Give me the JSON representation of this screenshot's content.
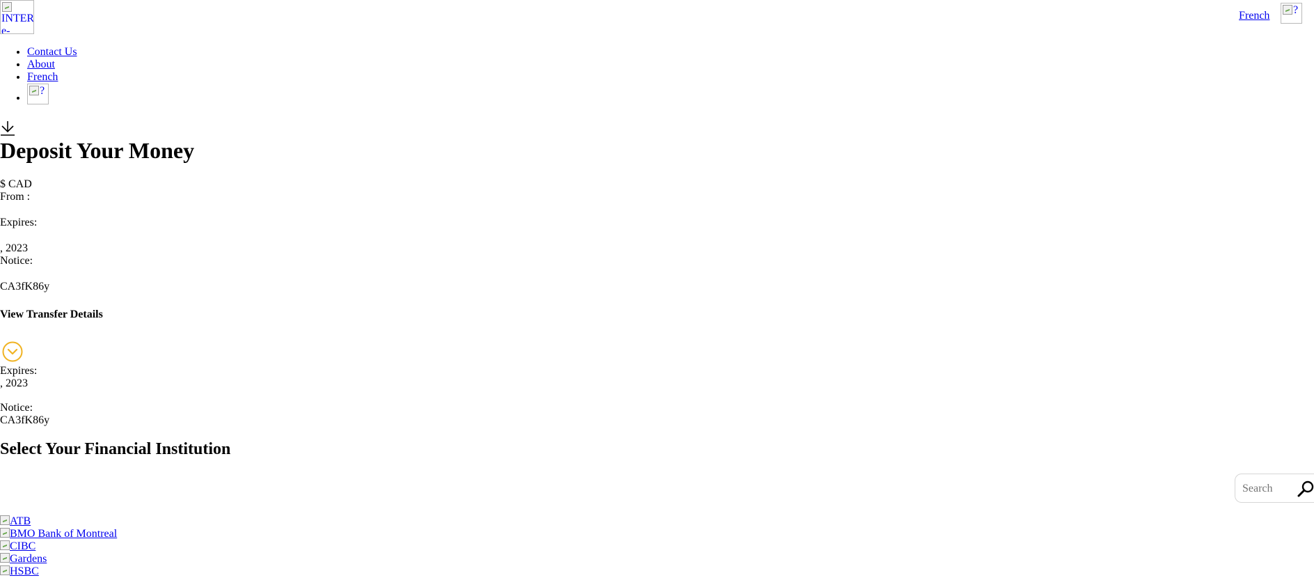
{
  "header": {
    "logo_alt": "INTER e-",
    "language_link": "French",
    "flag_alt": "?"
  },
  "nav": {
    "items": [
      {
        "label": "Contact Us"
      },
      {
        "label": "About"
      },
      {
        "label": "French"
      }
    ],
    "flag_alt": "?"
  },
  "deposit": {
    "title": "Deposit Your Money",
    "amount_text": "$ CAD",
    "from_label": "From :",
    "expires_label": "Expires:",
    "expires_value": ", 2023",
    "notice_label": "Notice:",
    "notice_value": "CA3fK86y",
    "view_details_label": "View Transfer Details"
  },
  "details": {
    "expires_label": "Expires:",
    "expires_value": ", 2023",
    "notice_label": "Notice:",
    "notice_value": "CA3fK86y"
  },
  "institutions": {
    "heading": "Select Your Financial Institution",
    "search_placeholder": "Search",
    "banks": [
      {
        "name": "ATB"
      },
      {
        "name": "BMO Bank of Montreal"
      },
      {
        "name": "CIBC"
      },
      {
        "name": "Gardens"
      },
      {
        "name": "HSBC"
      }
    ]
  },
  "colors": {
    "link": "#0000ee",
    "chevron_accent": "#f0b323"
  },
  "icons": [
    "download-icon",
    "chevron-down-circle-icon",
    "search-icon",
    "broken-image-icon"
  ]
}
